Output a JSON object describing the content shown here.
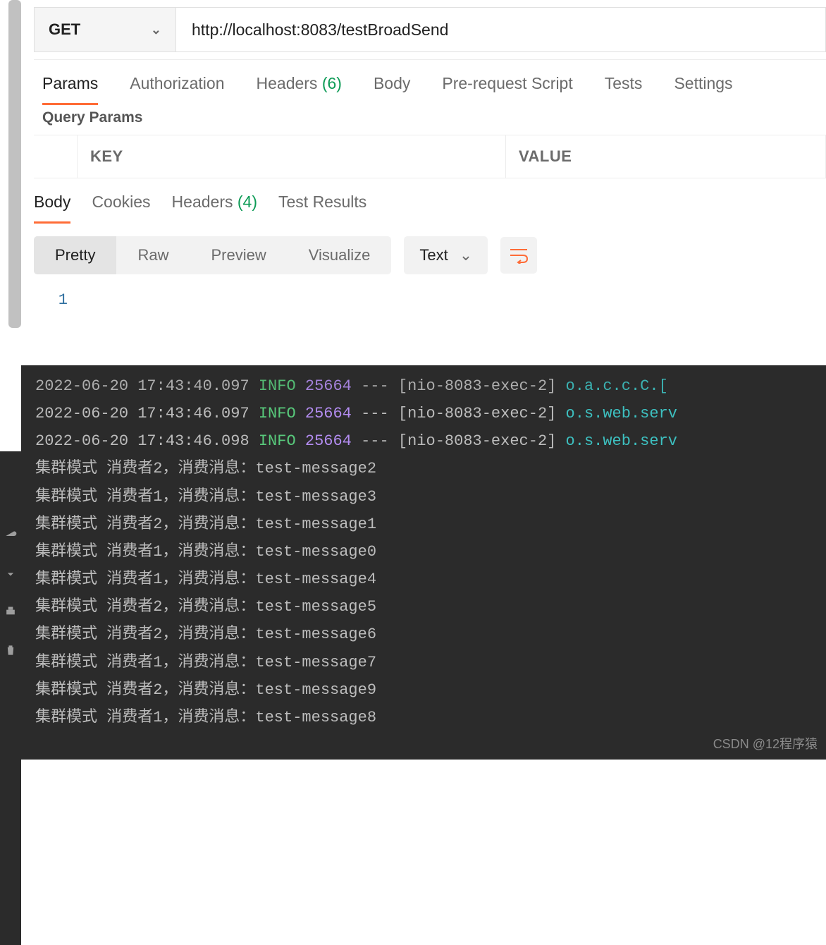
{
  "request": {
    "method": "GET",
    "url": "http://localhost:8083/testBroadSend"
  },
  "req_tabs": {
    "params": "Params",
    "auth": "Authorization",
    "headers": "Headers",
    "headers_count": "(6)",
    "body": "Body",
    "prereq": "Pre-request Script",
    "tests": "Tests",
    "settings": "Settings"
  },
  "qp": {
    "title": "Query Params",
    "key": "KEY",
    "value": "VALUE"
  },
  "res_tabs": {
    "body": "Body",
    "cookies": "Cookies",
    "headers": "Headers",
    "headers_count": "(4)",
    "tests": "Test Results"
  },
  "views": {
    "pretty": "Pretty",
    "raw": "Raw",
    "preview": "Preview",
    "visualize": "Visualize",
    "type": "Text"
  },
  "code": {
    "line1": "1"
  },
  "console": [
    {
      "kind": "partial",
      "ts": "2022-06-20 17:43:40.097",
      "lvl": "INFO",
      "pid": "25664",
      "thr": "[nio-8083-exec-2]",
      "cls": "o.a.c.c.C.["
    },
    {
      "kind": "log",
      "ts": "2022-06-20 17:43:46.097",
      "lvl": "INFO",
      "pid": "25664",
      "thr": "[nio-8083-exec-2]",
      "cls": "o.s.web.serv"
    },
    {
      "kind": "log",
      "ts": "2022-06-20 17:43:46.098",
      "lvl": "INFO",
      "pid": "25664",
      "thr": "[nio-8083-exec-2]",
      "cls": "o.s.web.serv"
    },
    {
      "kind": "msg",
      "text": "集群模式 消费者2，消费消息：test-message2"
    },
    {
      "kind": "msg",
      "text": "集群模式 消费者1，消费消息：test-message3"
    },
    {
      "kind": "msg",
      "text": "集群模式 消费者2，消费消息：test-message1"
    },
    {
      "kind": "msg",
      "text": "集群模式 消费者1，消费消息：test-message0"
    },
    {
      "kind": "msg",
      "text": "集群模式 消费者1，消费消息：test-message4"
    },
    {
      "kind": "msg",
      "text": "集群模式 消费者2，消费消息：test-message5"
    },
    {
      "kind": "msg",
      "text": "集群模式 消费者2，消费消息：test-message6"
    },
    {
      "kind": "msg",
      "text": "集群模式 消费者1，消费消息：test-message7"
    },
    {
      "kind": "msg",
      "text": "集群模式 消费者2，消费消息：test-message9"
    },
    {
      "kind": "msg",
      "text": "集群模式 消费者1，消费消息：test-message8"
    }
  ],
  "watermark": "CSDN @12程序猿"
}
